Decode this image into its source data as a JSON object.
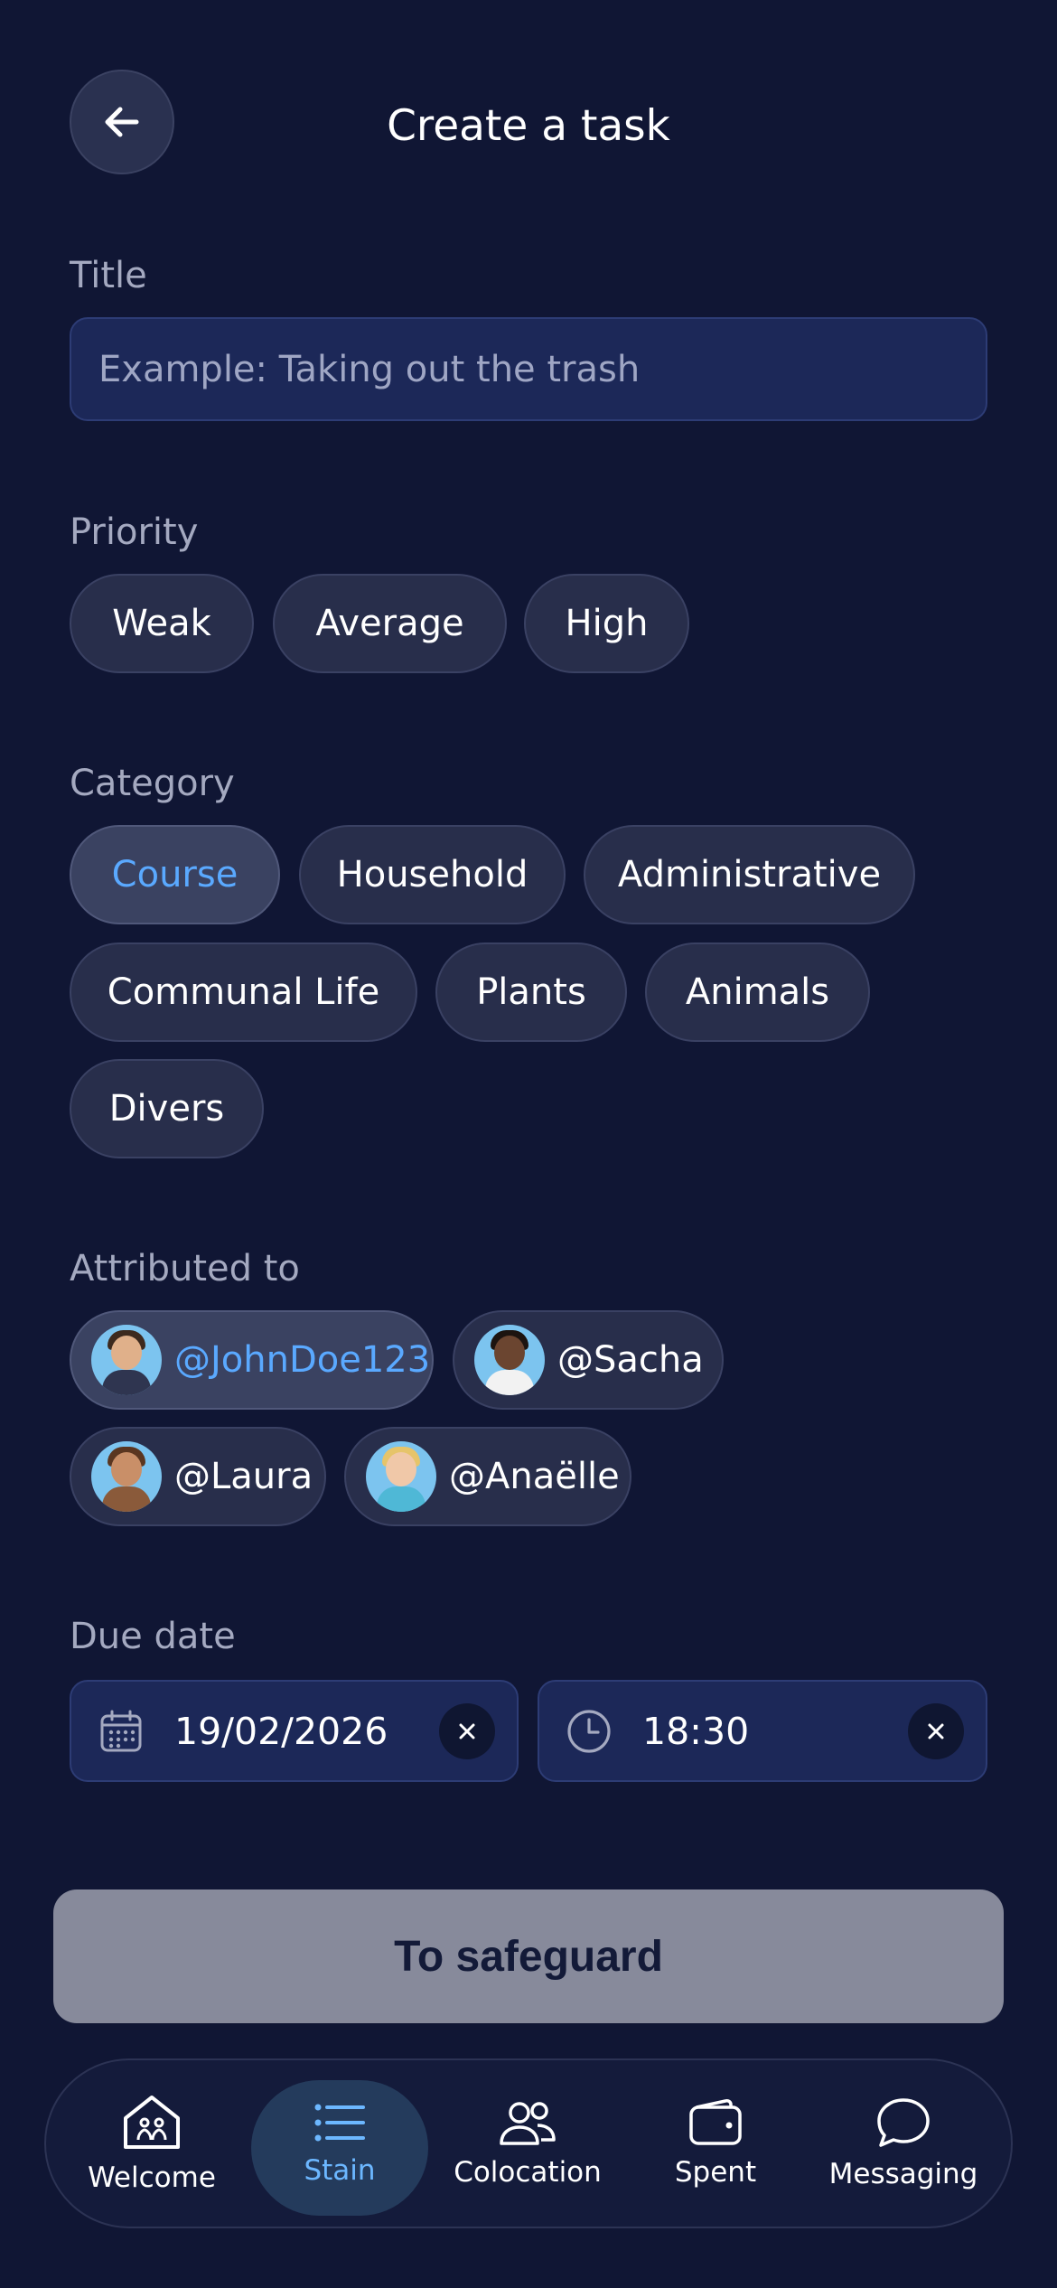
{
  "header": {
    "title": "Create a task",
    "back_icon": "arrow-left-icon"
  },
  "title_field": {
    "label": "Title",
    "placeholder": "Example: Taking out the trash",
    "value": ""
  },
  "priority": {
    "label": "Priority",
    "options": [
      "Weak",
      "Average",
      "High"
    ],
    "selected": null
  },
  "category": {
    "label": "Category",
    "options": [
      "Course",
      "Household",
      "Administrative",
      "Communal Life",
      "Plants",
      "Animals",
      "Divers"
    ],
    "selected": "Course"
  },
  "attributed": {
    "label": "Attributed to",
    "users": [
      "@JohnDoe123",
      "@Sacha",
      "@Laura",
      "@Anaëlle"
    ],
    "selected": "@JohnDoe123"
  },
  "due": {
    "label": "Due date",
    "date": "19/02/2026",
    "time": "18:30"
  },
  "save_label": "To safeguard",
  "nav": {
    "items": [
      "Welcome",
      "Stain",
      "Colocation",
      "Spent",
      "Messaging"
    ],
    "active": "Stain"
  },
  "colors": {
    "background": "#101634",
    "accent": "#5aa9ff",
    "input_bg": "#1c2858",
    "chip_bg": "#282e4b",
    "save_button": "#878a9b"
  }
}
